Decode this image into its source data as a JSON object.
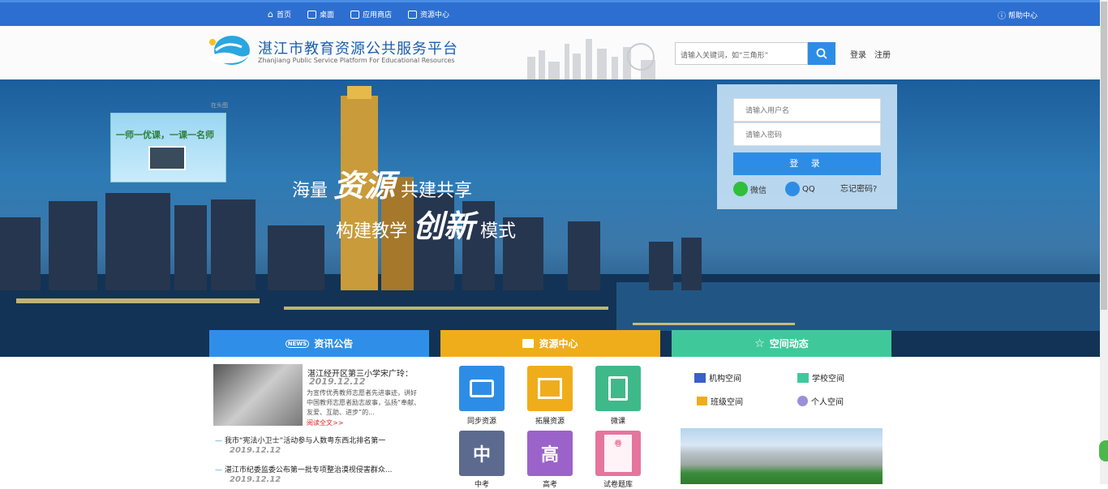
{
  "topbar": {
    "nav": [
      {
        "label": "首页",
        "icon": "home-icon"
      },
      {
        "label": "桌面",
        "icon": "desktop-icon"
      },
      {
        "label": "应用商店",
        "icon": "store-icon"
      },
      {
        "label": "资源中心",
        "icon": "monitor-icon"
      }
    ],
    "help": "帮助中心"
  },
  "header": {
    "title": "湛江市教育资源公共服务平台",
    "subtitle": "Zhanjiang Public Service Platform For Educational Resources",
    "search_placeholder": "请输入关键词，如“三角形”",
    "login": "登录",
    "register": "注册"
  },
  "banner": {
    "slogan1_pre": "海量",
    "slogan1_big": "资源",
    "slogan1_post": "共建共享",
    "slogan2_pre": "构建教学",
    "slogan2_big": "创新",
    "slogan2_post": "模式",
    "promo_text": "一师一优课，一课一名师",
    "promo_label": "在头图"
  },
  "login": {
    "username_placeholder": "请输入用户名",
    "password_placeholder": "请输入密码",
    "button": "登 录",
    "wechat": "微信",
    "qq": "QQ",
    "forgot": "忘记密码?"
  },
  "tabs": [
    {
      "label": "资讯公告",
      "color": "#2f8fe8"
    },
    {
      "label": "资源中心",
      "color": "#f0ad1b"
    },
    {
      "label": "空间动态",
      "color": "#3fc99a"
    }
  ],
  "news": {
    "headline": "湛江经开区第三小学宋广玲：",
    "date": "2019.12.12",
    "summary": "为宣传优秀教师志愿者先进事迹，讲好中国教师志愿者励志故事，弘扬“奉献、友爱、互助、进步”的...",
    "more": "阅读全文>>",
    "items": [
      {
        "title": "我市“宪法小卫士”活动参与人数粤东西北排名第一",
        "date": "2019.12.12"
      },
      {
        "title": "湛江市纪委监委公布第一批专项整治漠视侵害群众...",
        "date": "2019.12.12"
      }
    ]
  },
  "resources": [
    {
      "label": "同步资源",
      "glyph": "",
      "color": "#2d8de6"
    },
    {
      "label": "拓展资源",
      "glyph": "",
      "color": "#f0ad1b"
    },
    {
      "label": "微课",
      "glyph": "",
      "color": "#3fb98a"
    },
    {
      "label": "中考",
      "glyph": "中",
      "color": "#5b6a8e"
    },
    {
      "label": "高考",
      "glyph": "高",
      "color": "#9b63c9"
    },
    {
      "label": "试卷题库",
      "glyph": "卷",
      "color": "#e6759d"
    }
  ],
  "spaces": [
    {
      "label": "机构空间",
      "icon": "building-icon"
    },
    {
      "label": "学校空间",
      "icon": "school-icon"
    },
    {
      "label": "班级空间",
      "icon": "class-icon"
    },
    {
      "label": "个人空间",
      "icon": "person-icon"
    }
  ]
}
